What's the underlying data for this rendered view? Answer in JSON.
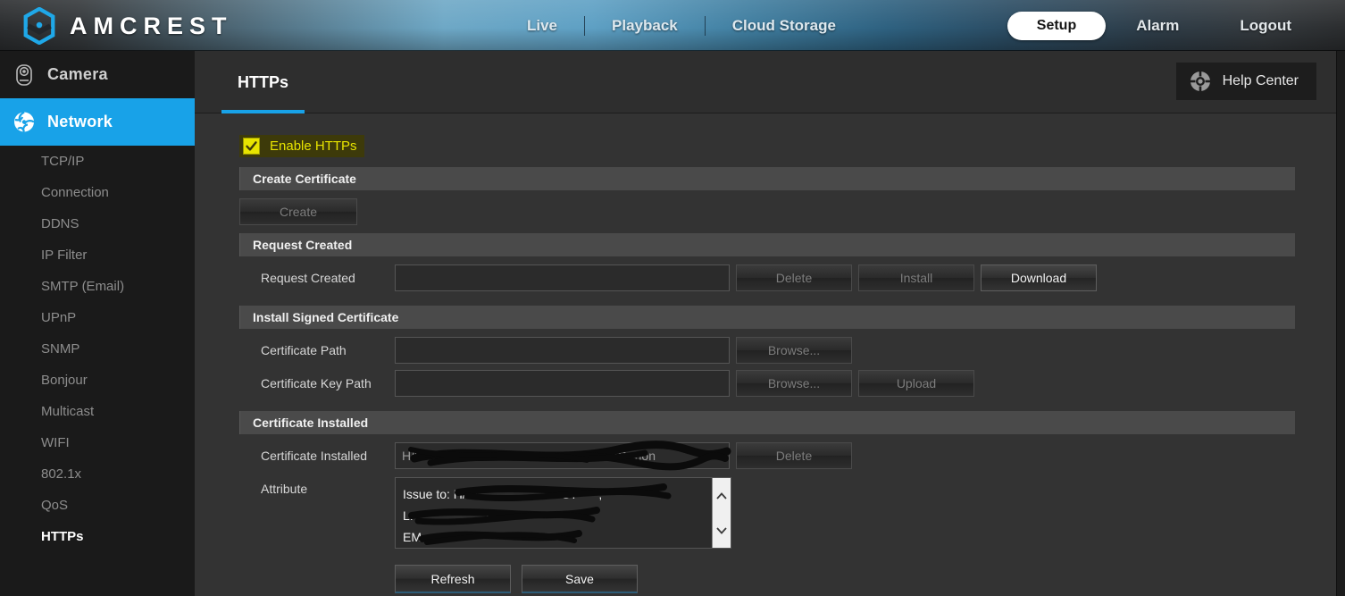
{
  "header": {
    "brand": "AMCREST",
    "logo_icon": "amcrest-hexagon-logo-icon",
    "nav": [
      {
        "label": "Live",
        "active": false
      },
      {
        "label": "Playback",
        "active": false
      },
      {
        "label": "Cloud Storage",
        "active": false
      }
    ],
    "nav_right": [
      {
        "label": "Setup",
        "active": true
      },
      {
        "label": "Alarm",
        "active": false
      },
      {
        "label": "Logout",
        "active": false
      }
    ],
    "accent_color": "#18a2e8",
    "highlight_pill_bg": "#ffffff"
  },
  "sidebar": {
    "groups": [
      {
        "label": "Camera",
        "icon": "camera-dome-icon",
        "active": false
      },
      {
        "label": "Network",
        "icon": "network-globe-icon",
        "active": true
      }
    ],
    "items": [
      {
        "label": "TCP/IP",
        "selected": false
      },
      {
        "label": "Connection",
        "selected": false
      },
      {
        "label": "DDNS",
        "selected": false
      },
      {
        "label": "IP Filter",
        "selected": false
      },
      {
        "label": "SMTP (Email)",
        "selected": false
      },
      {
        "label": "UPnP",
        "selected": false
      },
      {
        "label": "SNMP",
        "selected": false
      },
      {
        "label": "Bonjour",
        "selected": false
      },
      {
        "label": "Multicast",
        "selected": false
      },
      {
        "label": "WIFI",
        "selected": false
      },
      {
        "label": "802.1x",
        "selected": false
      },
      {
        "label": "QoS",
        "selected": false
      },
      {
        "label": "HTTPs",
        "selected": true
      }
    ]
  },
  "content": {
    "tab": "HTTPs",
    "help_button": {
      "label": "Help Center",
      "icon": "lifebuoy-help-icon"
    },
    "enable": {
      "label": "Enable HTTPs",
      "checked": true,
      "highlight_color": "#e8e400"
    },
    "sections": [
      {
        "title": "Create Certificate",
        "create_button": {
          "label": "Create",
          "disabled": true
        }
      },
      {
        "title": "Request Created",
        "row_label": "Request Created",
        "input_value": "",
        "buttons": [
          {
            "label": "Delete",
            "disabled": true
          },
          {
            "label": "Install",
            "disabled": true
          },
          {
            "label": "Download",
            "disabled": false
          }
        ]
      },
      {
        "title": "Install Signed Certificate",
        "rows": [
          {
            "label": "Certificate Path",
            "value": "",
            "buttons": [
              {
                "label": "Browse...",
                "disabled": true
              }
            ]
          },
          {
            "label": "Certificate Key Path",
            "value": "",
            "buttons": [
              {
                "label": "Browse...",
                "disabled": true
              },
              {
                "label": "Upload",
                "disabled": true
              }
            ]
          }
        ]
      },
      {
        "title": "Certificate Installed",
        "installed_label": "Certificate Installed",
        "installed_value": "H/IP=                        ST=CC;L=           ;O=non",
        "installed_button": {
          "label": "Delete",
          "disabled": true
        },
        "attribute_label": "Attribute",
        "attribute_lines": [
          "Issue to: H/IP=                      ST=    ;",
          "L:                     OU=",
          "EM                          "
        ],
        "scroll_up_icon": "chevron-up-icon",
        "scroll_down_icon": "chevron-down-icon"
      }
    ],
    "footer_buttons": [
      {
        "label": "Refresh"
      },
      {
        "label": "Save"
      }
    ]
  }
}
